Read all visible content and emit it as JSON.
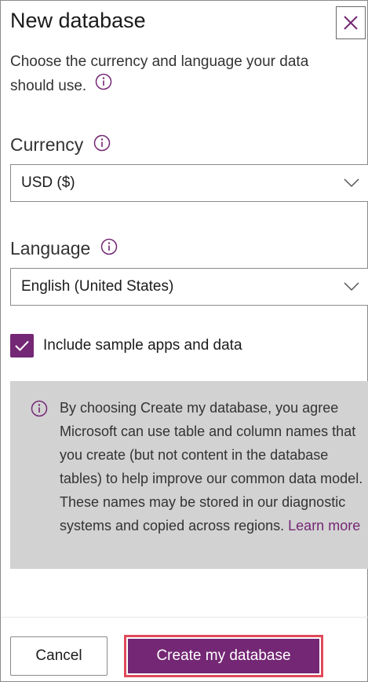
{
  "dialog": {
    "title": "New database",
    "intro": "Choose the currency and language your data should use.",
    "close_icon": "close-icon",
    "accent_color": "#742774",
    "highlight_color": "#e04a5a"
  },
  "currency": {
    "label": "Currency",
    "value": "USD ($)"
  },
  "language": {
    "label": "Language",
    "value": "English (United States)"
  },
  "sample": {
    "checked": true,
    "label": "Include sample apps and data"
  },
  "notice": {
    "text": "By choosing Create my database, you agree Microsoft can use table and column names that you create (but not content in the database tables) to help improve our common data model. These names may be stored in our diagnostic systems and copied across regions.",
    "link": "Learn more"
  },
  "footer": {
    "cancel_label": "Cancel",
    "create_label": "Create my database"
  }
}
